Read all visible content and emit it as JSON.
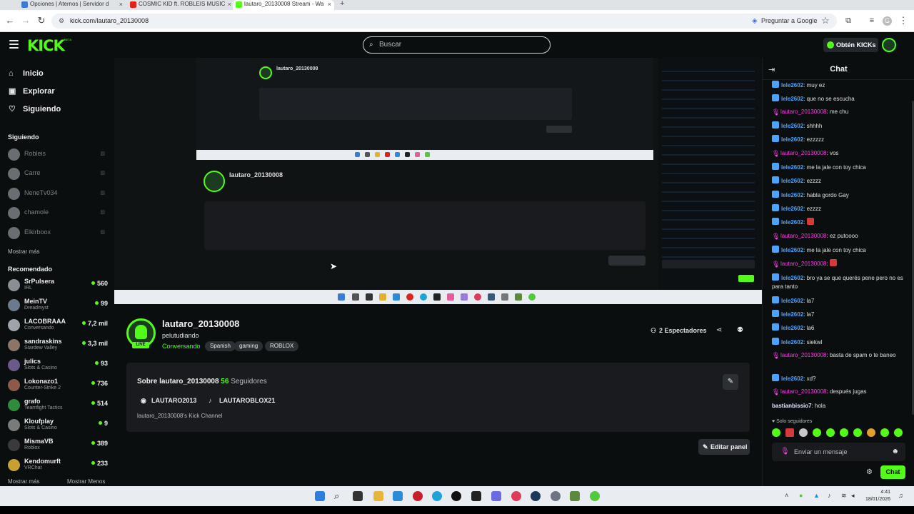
{
  "browser": {
    "tabs": [
      {
        "title": "Opciones | Aternos | Servidor d"
      },
      {
        "title": "COSMIC KID ft. ROBLEIS MUSIC"
      },
      {
        "title": "lautaro_20130008 Stream - Wa"
      }
    ],
    "new_tab": "+",
    "url": "kick.com/lautaro_20130008",
    "google_pill": "Preguntar a Google"
  },
  "header": {
    "logo": "KICK",
    "logo_badge": "BETA",
    "search_placeholder": "Buscar",
    "get_kicks": "Obtén KICKs"
  },
  "sidebar": {
    "nav": [
      {
        "label": "Inicio",
        "icon": "home-icon"
      },
      {
        "label": "Explorar",
        "icon": "explore-icon"
      },
      {
        "label": "Siguiendo",
        "icon": "heart-icon"
      }
    ],
    "following_heading": "Siguiendo",
    "following": [
      {
        "name": "Robleis"
      },
      {
        "name": "Carre"
      },
      {
        "name": "NeneTv034"
      },
      {
        "name": "chamole"
      },
      {
        "name": "Elkirboox"
      }
    ],
    "show_more_1": "Mostrar más",
    "recommended_heading": "Recomendado",
    "recommended": [
      {
        "name": "SrPulsera",
        "category": "IRL",
        "viewers": "560",
        "color": "#8a8f96"
      },
      {
        "name": "MeinTV",
        "category": "Dreadmyst",
        "viewers": "99",
        "color": "#6b7a8c"
      },
      {
        "name": "LACOBRAAA",
        "category": "Conversando",
        "viewers": "7,2 mil",
        "color": "#a0a4aa"
      },
      {
        "name": "sandraskins",
        "category": "Stardew Valley",
        "viewers": "3,3 mil",
        "color": "#8c7466"
      },
      {
        "name": "julics",
        "category": "Slots & Casino",
        "viewers": "93",
        "color": "#6a5a8c"
      },
      {
        "name": "Lokonazo1",
        "category": "Counter-Strike 2",
        "viewers": "736",
        "color": "#8c5a4a"
      },
      {
        "name": "grafo",
        "category": "Teamfight Tactics",
        "viewers": "514",
        "color": "#2e8c3a"
      },
      {
        "name": "Kloufplay",
        "category": "Slots & Casino",
        "viewers": "9",
        "color": "#7a7a7a"
      },
      {
        "name": "MismaVB",
        "category": "Roblox",
        "viewers": "389",
        "color": "#3a3a3a"
      },
      {
        "name": "Kendomurft",
        "category": "VRChat",
        "viewers": "233",
        "color": "#c8a030"
      }
    ],
    "show_more_2": "Mostrar más",
    "show_less": "Mostrar Menos"
  },
  "channel": {
    "name": "lautaro_20130008",
    "title": "pelutudiando",
    "category": "Conversando",
    "tags": [
      "Spanish",
      "gaming",
      "ROBLOX"
    ],
    "live": "LIVE",
    "viewers": "2 Espectadores",
    "about_title": "Sobre lautaro_20130008",
    "followers_count": "56",
    "followers_label": "Seguidores",
    "socials": [
      {
        "label": "LAUTARO2013",
        "icon": "discord-icon"
      },
      {
        "label": "LAUTAROBLOX21",
        "icon": "tiktok-icon"
      }
    ],
    "description": "lautaro_20130008's Kick Channel",
    "edit_panel": "Editar panel"
  },
  "chat": {
    "title": "Chat",
    "messages": [
      {
        "user": "lele2602",
        "type": "sub",
        "text": ": muy ez"
      },
      {
        "user": "lele2602",
        "type": "sub",
        "text": ": que no se escucha"
      },
      {
        "user": "lautaro_20130008",
        "type": "mod",
        "text": ": me chu"
      },
      {
        "user": "lele2602",
        "type": "sub",
        "text": ": shhhh"
      },
      {
        "user": "lele2602",
        "type": "sub",
        "text": ": ezzzzz"
      },
      {
        "user": "lautaro_20130008",
        "type": "mod",
        "text": ": vos"
      },
      {
        "user": "lele2602",
        "type": "sub",
        "text": ": me la jale con toy chica"
      },
      {
        "user": "lele2602",
        "type": "sub",
        "text": ": ezzzz"
      },
      {
        "user": "lele2602",
        "type": "sub",
        "text": ": habla gordo Gay"
      },
      {
        "user": "lele2602",
        "type": "sub",
        "text": ": ezzzz"
      },
      {
        "user": "lele2602",
        "type": "sub",
        "text": ":",
        "emote": true
      },
      {
        "user": "lautaro_20130008",
        "type": "mod",
        "text": ": ez putoooo"
      },
      {
        "user": "lele2602",
        "type": "sub",
        "text": ": me la jale con toy chica"
      },
      {
        "user": "lautaro_20130008",
        "type": "mod",
        "text": ":",
        "emote": true
      },
      {
        "user": "lele2602",
        "type": "sub",
        "text": ": bro ya se que querés pene pero no es para tanto"
      },
      {
        "user": "lele2602",
        "type": "sub",
        "text": ": la7"
      },
      {
        "user": "lele2602",
        "type": "sub",
        "text": ": la7"
      },
      {
        "user": "lele2602",
        "type": "sub",
        "text": ": la6"
      },
      {
        "user": "lele2602",
        "type": "sub",
        "text": ": siekwl"
      },
      {
        "user": "lautaro_20130008",
        "type": "mod",
        "text": ": basta de spam o te baneo"
      },
      {
        "user": "lele2602",
        "type": "sub",
        "text": ": xd?"
      },
      {
        "user": "lautaro_20130008",
        "type": "mod",
        "text": ": después jugas"
      },
      {
        "user": "bastianbissio7",
        "type": "plain",
        "text": ": hola"
      }
    ],
    "solo_seguidores": "Solo seguidores",
    "input_placeholder": "Enviar un mensaje",
    "send": "Chat"
  },
  "taskbar": {
    "time": "4:41",
    "date": "18/01/2026"
  },
  "colors": {
    "kick_green": "#53fc18",
    "background": "#0b0e0f",
    "card": "#191b1f",
    "sub_user": "#4aa3ff",
    "mod_user": "#ff3be8"
  }
}
